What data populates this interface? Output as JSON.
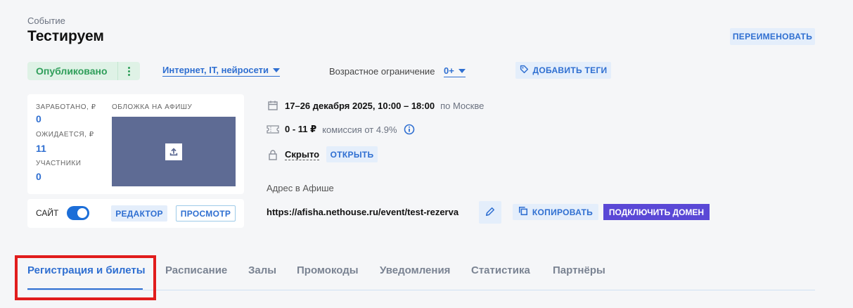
{
  "header": {
    "kicker": "Событие",
    "title": "Тестируем",
    "rename_label": "ПЕРЕИМЕНОВАТЬ"
  },
  "meta": {
    "status_label": "Опубликовано",
    "category_value": "Интернет, IT, нейросети",
    "age_label": "Возрастное ограничение",
    "age_value": "0+",
    "add_tags_label": "ДОБАВИТЬ ТЕГИ"
  },
  "stats": {
    "earned_label": "ЗАРАБОТАНО, ₽",
    "earned_value": "0",
    "expected_label": "ОЖИДАЕТСЯ, ₽",
    "expected_value": "11",
    "participants_label": "УЧАСТНИКИ",
    "participants_value": "0",
    "cover_label": "ОБЛОЖКА НА АФИШУ"
  },
  "site": {
    "label": "САЙТ",
    "enabled": true,
    "editor_label": "РЕДАКТОР",
    "preview_label": "ПРОСМОТР"
  },
  "details": {
    "date": "17–26 декабря 2025, 10:00 – 18:00",
    "timezone": "по Москве",
    "price": "0 - 11 ₽",
    "commission": "комиссия от 4.9%",
    "visibility": "Скрыто",
    "open_label": "ОТКРЫТЬ"
  },
  "address": {
    "label": "Адрес в Афише",
    "url": "https://afisha.nethouse.ru/event/test-rezerva",
    "copy_label": "КОПИРОВАТЬ",
    "domain_label": "ПОДКЛЮЧИТЬ ДОМЕН"
  },
  "tabs": [
    {
      "label": "Регистрация и билеты",
      "active": true
    },
    {
      "label": "Расписание"
    },
    {
      "label": "Залы"
    },
    {
      "label": "Промокоды"
    },
    {
      "label": "Уведомления"
    },
    {
      "label": "Статистика"
    },
    {
      "label": "Партнёры"
    }
  ],
  "colors": {
    "accent": "#2f6fd1",
    "published": "#2f9e5a",
    "domain_button": "#5a48d6",
    "highlight": "#e11d1d"
  },
  "icons": [
    "more-vertical-icon",
    "tag-icon",
    "upload-icon",
    "calendar-icon",
    "ticket-icon",
    "info-icon",
    "lock-icon",
    "pencil-icon",
    "copy-icon"
  ]
}
